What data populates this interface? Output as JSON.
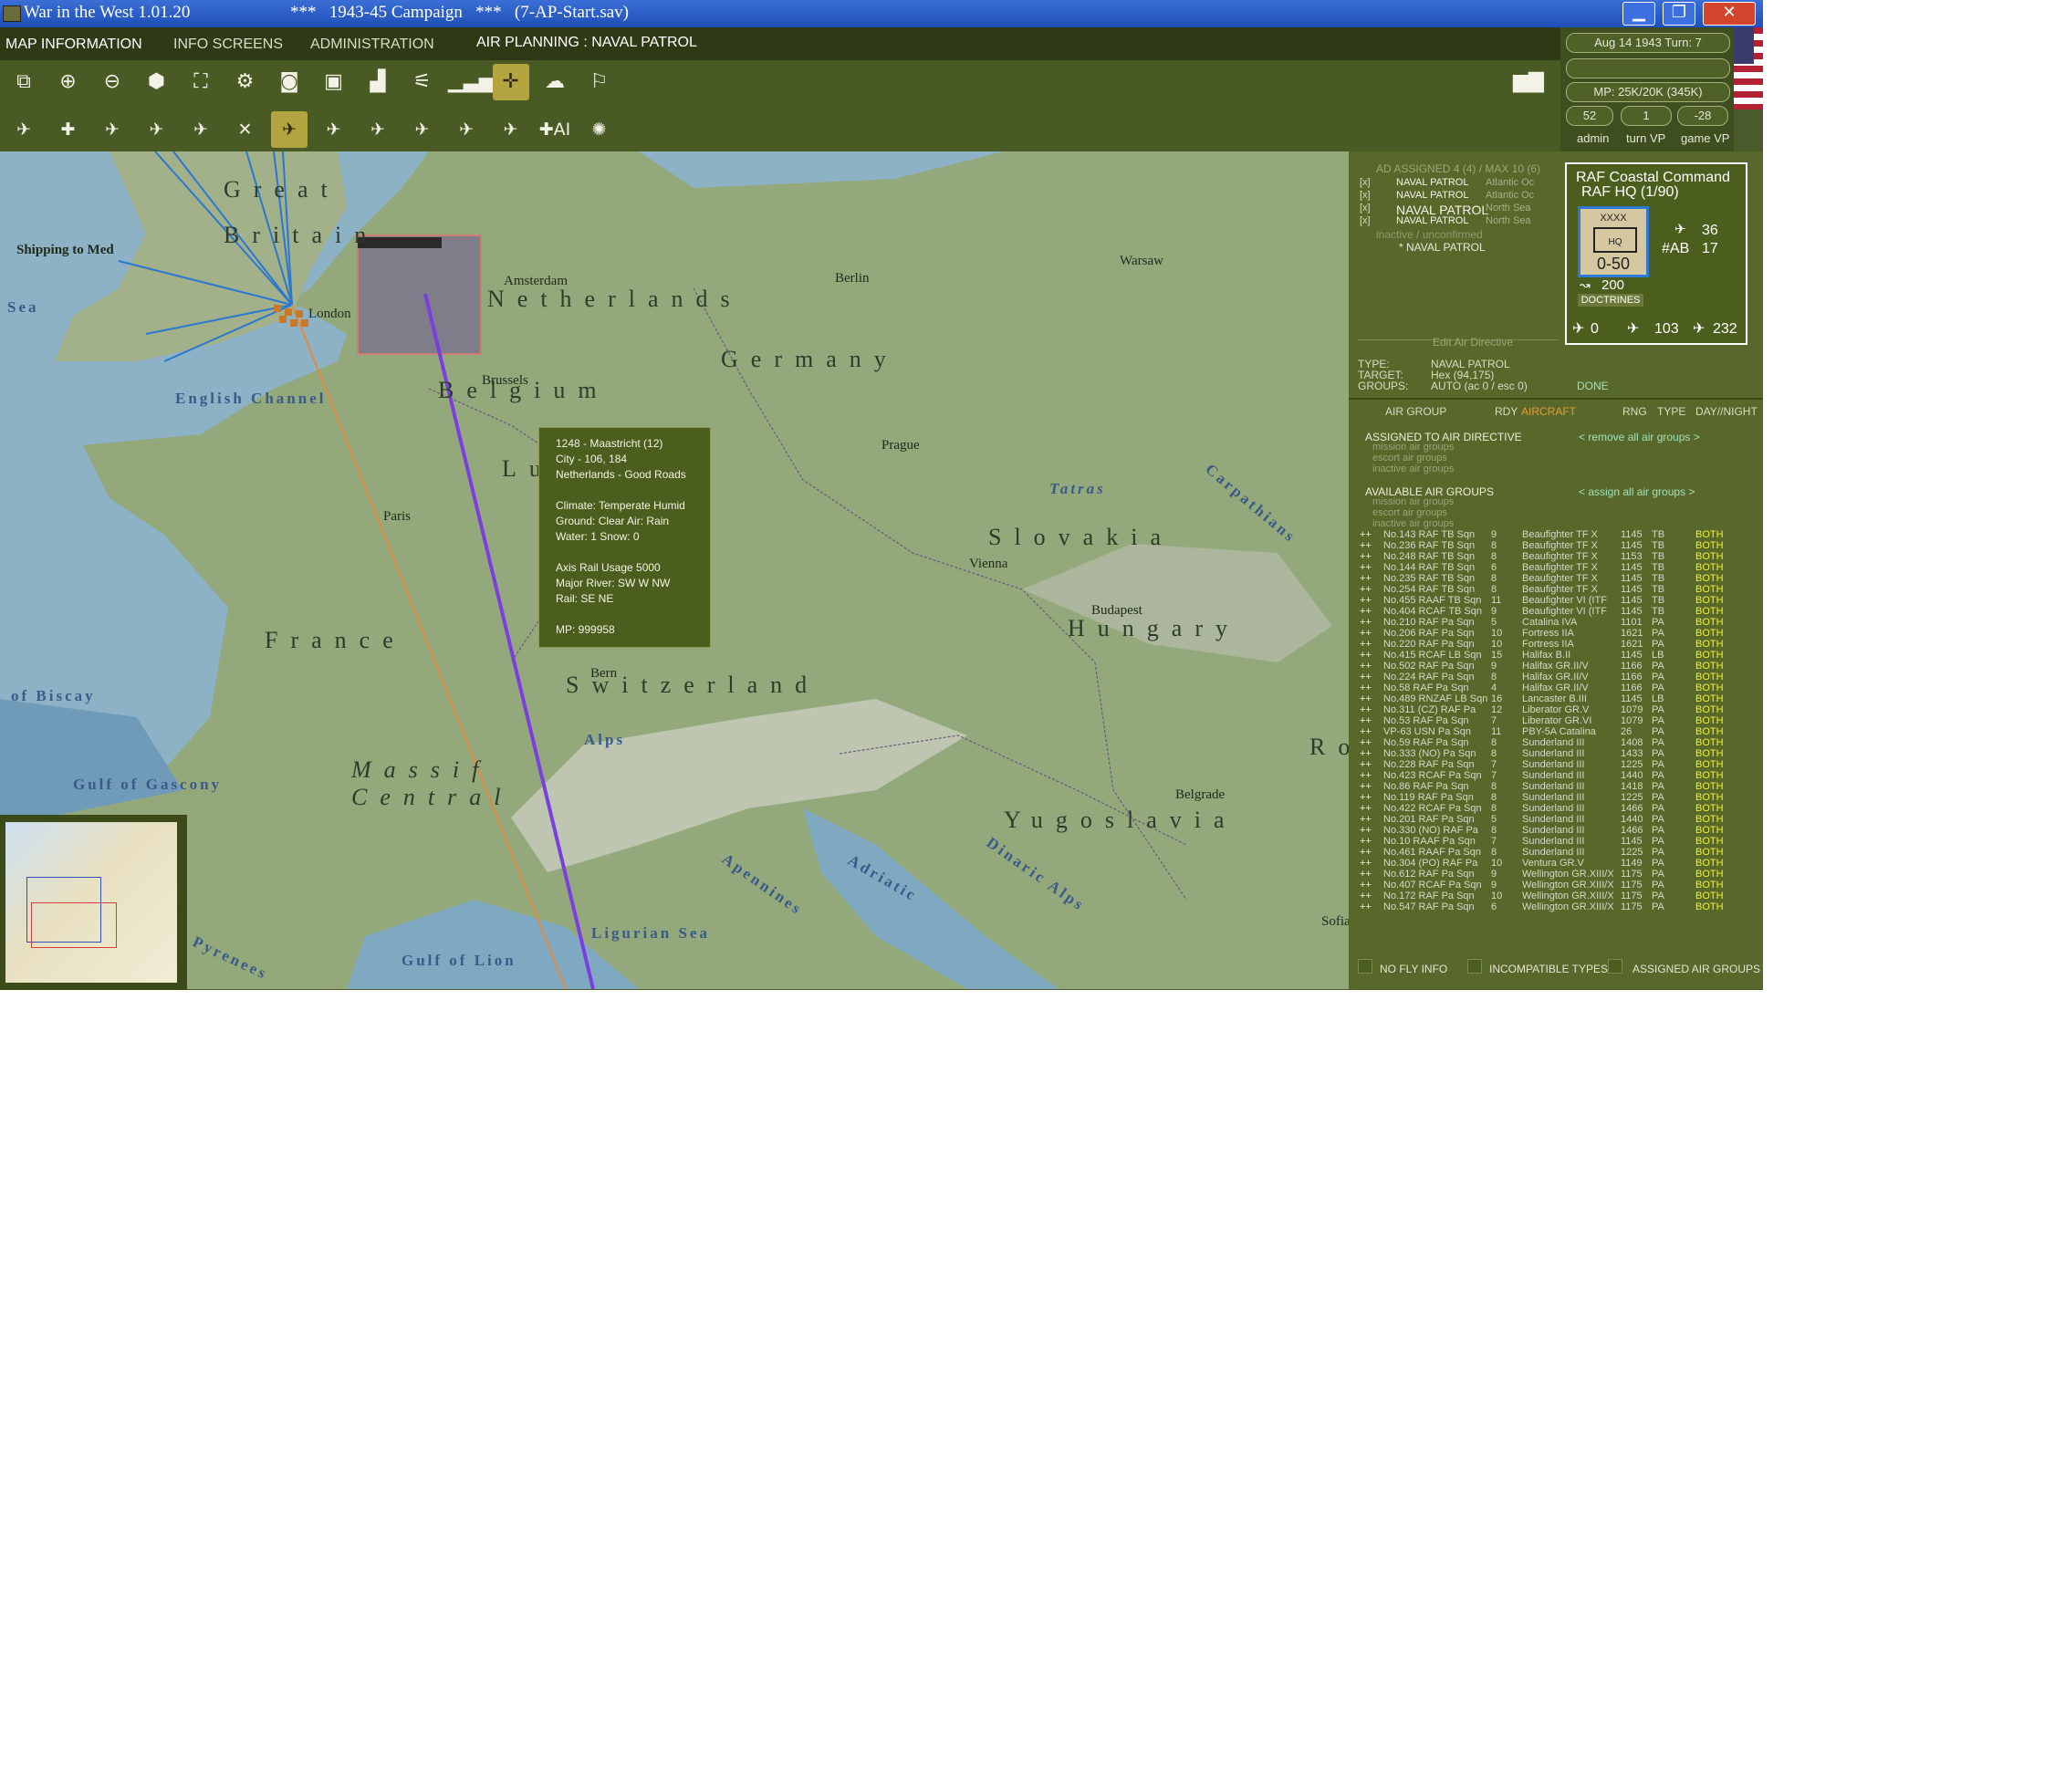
{
  "window": {
    "title": "War in the West 1.01.20",
    "campaign": "***   1943-45 Campaign   ***   (7-AP-Start.sav)",
    "minimize": "▁",
    "maximize": "❐",
    "close": "✕"
  },
  "menu": {
    "map_info": "MAP INFORMATION",
    "info_screens": "INFO SCREENS",
    "administration": "ADMINISTRATION",
    "air_planning": "AIR PLANNING : NAVAL PATROL"
  },
  "toolbar_row1": [
    {
      "icon": "window-icon",
      "glyph": "⧉"
    },
    {
      "icon": "zoom-in-icon",
      "glyph": "⊕"
    },
    {
      "icon": "zoom-out-icon",
      "glyph": "⊖"
    },
    {
      "icon": "hex-group-icon",
      "glyph": "⬢"
    },
    {
      "icon": "frame-icon",
      "glyph": "⛶"
    },
    {
      "icon": "settings-gear-icon",
      "glyph": "⚙"
    },
    {
      "icon": "unit-display-icon",
      "glyph": "◙"
    },
    {
      "icon": "display-screen-icon",
      "glyph": "▣"
    },
    {
      "icon": "factory-icon",
      "glyph": "▟"
    },
    {
      "icon": "air-signal-icon",
      "glyph": "⚟"
    },
    {
      "icon": "air-bars-icon",
      "glyph": "▁▃▅"
    },
    {
      "icon": "air-target-icon",
      "glyph": "✛"
    },
    {
      "icon": "weather-icon",
      "glyph": "☁"
    },
    {
      "icon": "flag-icon",
      "glyph": "⚐"
    }
  ],
  "toolbar_row2": [
    {
      "icon": "air-f1-icon",
      "glyph": "✈"
    },
    {
      "icon": "air-f2-icon",
      "glyph": "✚"
    },
    {
      "icon": "air-f3-icon",
      "glyph": "✈"
    },
    {
      "icon": "air-f4-icon",
      "glyph": "✈"
    },
    {
      "icon": "air-f5-icon",
      "glyph": "✈"
    },
    {
      "icon": "air-f6-icon",
      "glyph": "✕"
    },
    {
      "icon": "air-f7-icon",
      "glyph": "✈"
    },
    {
      "icon": "air-f8-icon",
      "glyph": "✈"
    },
    {
      "icon": "air-f9-icon",
      "glyph": "✈"
    },
    {
      "icon": "air-f10-icon",
      "glyph": "✈"
    },
    {
      "icon": "air-f11-icon",
      "glyph": "✈"
    },
    {
      "icon": "air-f12-icon",
      "glyph": "✈"
    },
    {
      "icon": "air-ai-icon",
      "glyph": "✚AI"
    },
    {
      "icon": "air-burst-icon",
      "glyph": "✺"
    }
  ],
  "status": {
    "date_turn": "Aug 14 1943  Turn: 7",
    "mp": "MP:  25K/20K (345K)",
    "admin_value": "52",
    "turn_vp_value": "1",
    "game_vp_value": "-28",
    "admin_label": "admin",
    "turn_vp_label": "turn VP",
    "game_vp_label": "game VP"
  },
  "map": {
    "cities": [
      "London",
      "Amsterdam",
      "Berlin",
      "Warsaw",
      "Brussels",
      "Paris",
      "Prague",
      "Vienna",
      "Budapest",
      "Bern",
      "Belgrade",
      "Sofia"
    ],
    "countries": [
      "Great",
      "Britain",
      "Netherlands",
      "Germany",
      "Belgium",
      "Lux",
      "Slovakia",
      "Hungary",
      "France",
      "Switzerland",
      "Yugoslavia",
      "Ro",
      "Massif",
      "Central"
    ],
    "seas": [
      "English Channel",
      "of Biscay",
      "Gulf of Gascony",
      "Gulf of Lion",
      "Ligurian Sea",
      "Adriatic",
      "Apennines",
      "Tatras",
      "Dinaric Alps",
      "Pyrenees",
      "Carpathians",
      "Alps",
      "Sea"
    ],
    "shipping_label": "Shipping to Med"
  },
  "tooltip": {
    "line1": "1248 - Maastricht (12)",
    "line2": "City - 106, 184",
    "line3": "Netherlands - Good Roads",
    "line4": "Climate: Temperate Humid",
    "line5": "Ground: Clear  Air: Rain",
    "line6": "Water: 1  Snow: 0",
    "line7": "Axis Rail  Usage 5000",
    "line8": "Major River: SW W NW",
    "line9": "Rail: SE NE",
    "line10": "MP: 999958"
  },
  "directives": {
    "header": "AD ASSIGNED 4 (4) / MAX 10 (6)",
    "items": [
      {
        "mark": "[x]",
        "label": "NAVAL PATROL",
        "area": "Atlantic Oc"
      },
      {
        "mark": "[x]",
        "label": "NAVAL PATROL",
        "area": "Atlantic Oc"
      },
      {
        "mark": "[x]",
        "label": "NAVAL PATROL",
        "area": "North Sea"
      },
      {
        "mark": "[x]",
        "label": "NAVAL PATROL",
        "area": "North Sea"
      }
    ],
    "inactive": "inactive / unconfirmed",
    "new_item": "* NAVAL PATROL",
    "edit_header": "Edit Air Directive",
    "type_label": "TYPE:",
    "type_value": "NAVAL PATROL",
    "target_label": "TARGET:",
    "target_value": "Hex (94,175)",
    "groups_label": "GROUPS:",
    "groups_value": "AUTO (ac 0 / esc 0)",
    "done": "DONE"
  },
  "unit": {
    "name": "RAF Coastal Command",
    "hq": "RAF HQ  (1/90)",
    "xxxx": "XXXX",
    "hq_label": "HQ",
    "strength": "0-50",
    "val_36": "36",
    "ab_label": "#AB",
    "val_17": "17",
    "val_200": "200",
    "doctrines": "DOCTRINES",
    "bottom_0": "0",
    "bottom_103": "103",
    "bottom_232": "232"
  },
  "air_table": {
    "col_group": "AIR GROUP",
    "col_rdy": "RDY",
    "col_aircraft": "AIRCRAFT",
    "col_rng": "RNG",
    "col_type": "TYPE",
    "col_day_night": "DAY//NIGHT",
    "assigned_header": "ASSIGNED TO AIR DIRECTIVE",
    "remove_all": "< remove all air groups >",
    "mission": "mission air groups",
    "escort": "escort air groups",
    "inactive": "inactive air groups",
    "available_header": "AVAILABLE AIR GROUPS",
    "assign_all": "< assign all air groups >",
    "mission2": "mission air groups",
    "escort2": "escort air groups",
    "inactive2": "inactive air groups",
    "rows": [
      [
        "++",
        "No.143 RAF TB Sqn",
        "9",
        "Beaufighter TF X",
        "1145",
        "TB",
        "BOTH"
      ],
      [
        "++",
        "No.236 RAF TB Sqn",
        "8",
        "Beaufighter TF X",
        "1145",
        "TB",
        "BOTH"
      ],
      [
        "++",
        "No.248 RAF TB Sqn",
        "8",
        "Beaufighter TF X",
        "1153",
        "TB",
        "BOTH"
      ],
      [
        "++",
        "No.144 RAF TB Sqn",
        "6",
        "Beaufighter TF X",
        "1145",
        "TB",
        "BOTH"
      ],
      [
        "++",
        "No.235 RAF TB Sqn",
        "8",
        "Beaufighter TF X",
        "1145",
        "TB",
        "BOTH"
      ],
      [
        "++",
        "No.254 RAF TB Sqn",
        "8",
        "Beaufighter TF X",
        "1145",
        "TB",
        "BOTH"
      ],
      [
        "++",
        "No.455 RAAF TB Sqn",
        "11",
        "Beaufighter VI (ITF",
        "1145",
        "TB",
        "BOTH"
      ],
      [
        "++",
        "No.404 RCAF TB Sqn",
        "9",
        "Beaufighter VI (ITF",
        "1145",
        "TB",
        "BOTH"
      ],
      [
        "++",
        "No.210 RAF Pa Sqn",
        "5",
        "Catalina IVA",
        "1101",
        "PA",
        "BOTH"
      ],
      [
        "++",
        "No.206 RAF Pa Sqn",
        "10",
        "Fortress IIA",
        "1621",
        "PA",
        "BOTH"
      ],
      [
        "++",
        "No.220 RAF Pa Sqn",
        "10",
        "Fortress IIA",
        "1621",
        "PA",
        "BOTH"
      ],
      [
        "++",
        "No.415 RCAF LB Sqn",
        "15",
        "Halifax B.II",
        "1145",
        "LB",
        "BOTH"
      ],
      [
        "++",
        "No.502 RAF Pa Sqn",
        "9",
        "Halifax GR.II/V",
        "1166",
        "PA",
        "BOTH"
      ],
      [
        "++",
        "No.224 RAF Pa Sqn",
        "8",
        "Halifax GR.II/V",
        "1166",
        "PA",
        "BOTH"
      ],
      [
        "++",
        "No.58 RAF Pa Sqn",
        "4",
        "Halifax GR.II/V",
        "1166",
        "PA",
        "BOTH"
      ],
      [
        "++",
        "No.489 RNZAF LB Sqn",
        "16",
        "Lancaster B.III",
        "1145",
        "LB",
        "BOTH"
      ],
      [
        "++",
        "No.311 (CZ) RAF Pa",
        "12",
        "Liberator GR.V",
        "1079",
        "PA",
        "BOTH"
      ],
      [
        "++",
        "No.53 RAF Pa Sqn",
        "7",
        "Liberator GR.VI",
        "1079",
        "PA",
        "BOTH"
      ],
      [
        "++",
        "VP-63 USN Pa Sqn",
        "11",
        "PBY-5A Catalina",
        "26",
        "PA",
        "BOTH"
      ],
      [
        "++",
        "No.59 RAF Pa Sqn",
        "8",
        "Sunderland III",
        "1408",
        "PA",
        "BOTH"
      ],
      [
        "++",
        "No.333 (NO) Pa Sqn",
        "8",
        "Sunderland III",
        "1433",
        "PA",
        "BOTH"
      ],
      [
        "++",
        "No.228 RAF Pa Sqn",
        "7",
        "Sunderland III",
        "1225",
        "PA",
        "BOTH"
      ],
      [
        "++",
        "No.423 RCAF Pa Sqn",
        "7",
        "Sunderland III",
        "1440",
        "PA",
        "BOTH"
      ],
      [
        "++",
        "No.86 RAF Pa Sqn",
        "8",
        "Sunderland III",
        "1418",
        "PA",
        "BOTH"
      ],
      [
        "++",
        "No.119 RAF Pa Sqn",
        "8",
        "Sunderland III",
        "1225",
        "PA",
        "BOTH"
      ],
      [
        "++",
        "No.422 RCAF Pa Sqn",
        "8",
        "Sunderland III",
        "1466",
        "PA",
        "BOTH"
      ],
      [
        "++",
        "No.201 RAF Pa Sqn",
        "5",
        "Sunderland III",
        "1440",
        "PA",
        "BOTH"
      ],
      [
        "++",
        "No.330 (NO) RAF Pa",
        "8",
        "Sunderland III",
        "1466",
        "PA",
        "BOTH"
      ],
      [
        "++",
        "No.10 RAAF Pa Sqn",
        "7",
        "Sunderland III",
        "1145",
        "PA",
        "BOTH"
      ],
      [
        "++",
        "No.461 RAAF Pa Sqn",
        "8",
        "Sunderland III",
        "1225",
        "PA",
        "BOTH"
      ],
      [
        "++",
        "No.304 (PO) RAF Pa",
        "10",
        "Ventura GR.V",
        "1149",
        "PA",
        "BOTH"
      ],
      [
        "++",
        "No.612 RAF Pa Sqn",
        "9",
        "Wellington GR.XIII/X",
        "1175",
        "PA",
        "BOTH"
      ],
      [
        "++",
        "No.407 RCAF Pa Sqn",
        "9",
        "Wellington GR.XIII/X",
        "1175",
        "PA",
        "BOTH"
      ],
      [
        "++",
        "No.172 RAF Pa Sqn",
        "10",
        "Wellington GR.XIII/X",
        "1175",
        "PA",
        "BOTH"
      ],
      [
        "++",
        "No.547 RAF Pa Sqn",
        "6",
        "Wellington GR.XIII/X",
        "1175",
        "PA",
        "BOTH"
      ]
    ]
  },
  "footer": {
    "no_fly": "NO FLY INFO",
    "incompatible": "INCOMPATIBLE TYPES",
    "assigned": "ASSIGNED AIR GROUPS"
  }
}
